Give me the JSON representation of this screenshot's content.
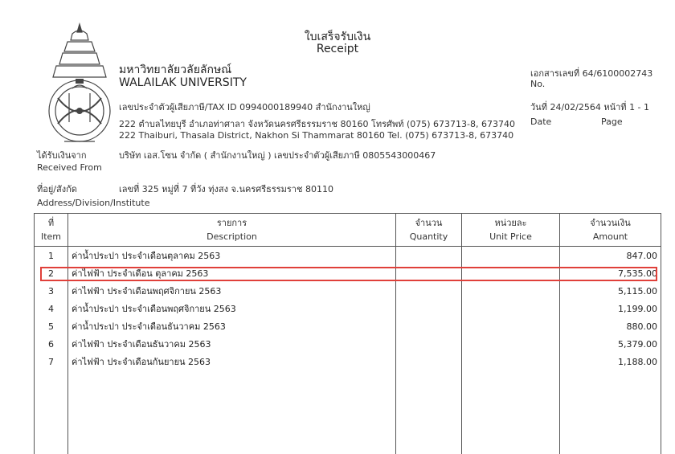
{
  "title": {
    "th": "ใบเสร็จรับเงิน",
    "en": "Receipt"
  },
  "university": {
    "name_th": "มหาวิทยาลัยวลัยลักษณ์",
    "name_en": "WALAILAK UNIVERSITY"
  },
  "issuer": {
    "tax_line": "เลขประจำตัวผู้เสียภาษี/TAX ID 0994000189940 สำนักงานใหญ่",
    "address_th": "222 ตำบลไทยบุรี อำเภอท่าศาลา จังหวัดนครศรีธรรมราช 80160 โทรศัพท์ (075) 673713-8, 673740",
    "address_en": "222 Thaiburi, Thasala District, Nakhon Si Thammarat 80160 Tel. (075) 673713-8, 673740"
  },
  "doc_no": {
    "label": "เอกสารเลขที่",
    "value": "64/6100002743",
    "label_en": "No."
  },
  "date_page": {
    "label": "วันที่",
    "date": "24/02/2564",
    "page_label": "หน้าที่",
    "page": "1 - 1",
    "date_en": "Date",
    "page_en": "Page"
  },
  "received_from": {
    "label_th": "ได้รับเงินจาก",
    "label_en": "Received From",
    "value": "บริษัท เอส.โซน จำกัด   ( สำนักงานใหญ่ ) เลขประจำตัวผู้เสียภาษี 0805543000467"
  },
  "address": {
    "label_th": "ที่อยู่/สังกัด",
    "label_en": "Address/Division/Institute",
    "value": "เลขที่ 325   หมู่ที่ 7   ที่วัง ทุ่งสง จ.นครศรีธรรมราช 80110"
  },
  "table": {
    "headers": [
      {
        "th": "ที่",
        "en": "Item"
      },
      {
        "th": "รายการ",
        "en": "Description"
      },
      {
        "th": "จำนวน",
        "en": "Quantity"
      },
      {
        "th": "หน่วยละ",
        "en": "Unit Price"
      },
      {
        "th": "จำนวนเงิน",
        "en": "Amount"
      }
    ],
    "rows": [
      {
        "no": "1",
        "desc": "ค่าน้ำประปา ประจำเดือนตุลาคม 2563",
        "amount": "847.00"
      },
      {
        "no": "2",
        "desc": "ค่าไฟฟ้า ประจำเดือน ตุลาคม 2563",
        "amount": "7,535.00"
      },
      {
        "no": "3",
        "desc": "ค่าไฟฟ้า ประจำเดือนพฤศจิกายน 2563",
        "amount": "5,115.00"
      },
      {
        "no": "4",
        "desc": "ค่าน้ำประปา ประจำเดือนพฤศจิกายน 2563",
        "amount": "1,199.00"
      },
      {
        "no": "5",
        "desc": "ค่าน้ำประปา ประจำเดือนธันวาคม 2563",
        "amount": "880.00"
      },
      {
        "no": "6",
        "desc": "ค่าไฟฟ้า ประจำเดือนธันวาคม 2563",
        "amount": "5,379.00"
      },
      {
        "no": "7",
        "desc": "ค่าไฟฟ้า ประจำเดือนกันยายน 2563",
        "amount": "1,188.00"
      }
    ]
  },
  "colors": {
    "highlight": "#e0403a"
  }
}
